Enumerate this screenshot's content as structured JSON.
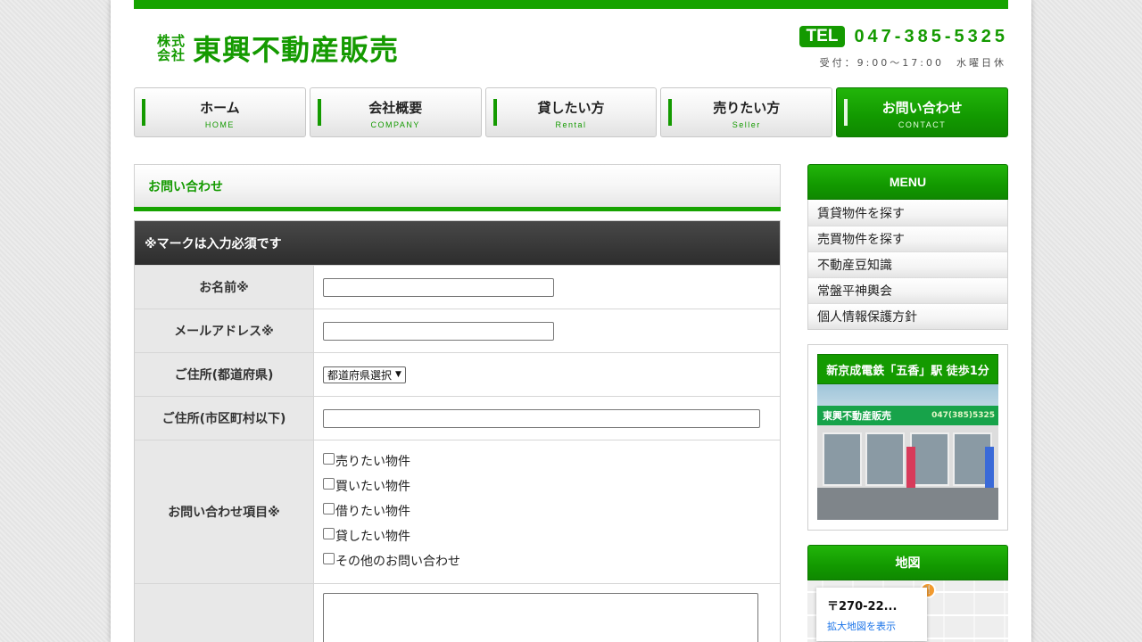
{
  "colors": {
    "brand": "#149a00",
    "header_dark": "#333333"
  },
  "logo": {
    "small_line1": "株式",
    "small_line2": "会社",
    "name": "東興不動産販売"
  },
  "contact": {
    "tel_badge": "TEL",
    "tel_number": "047-385-5325",
    "hours": "受付：9:00～17:00　水曜日休"
  },
  "nav": [
    {
      "label": "ホーム",
      "sub": "HOME"
    },
    {
      "label": "会社概要",
      "sub": "COMPANY"
    },
    {
      "label": "貸したい方",
      "sub": "Rental"
    },
    {
      "label": "売りたい方",
      "sub": "Seller"
    },
    {
      "label": "お問い合わせ",
      "sub": "CONTACT"
    }
  ],
  "main": {
    "section_title": "お問い合わせ",
    "form": {
      "note": "※マークは入力必須です",
      "name_label": "お名前※",
      "name_value": "",
      "email_label": "メールアドレス※",
      "email_value": "",
      "pref_label": "ご住所(都道府県)",
      "pref_selected": "都道府県選択",
      "city_label": "ご住所(市区町村以下)",
      "city_value": "",
      "inquiry_label": "お問い合わせ項目※",
      "inquiry_options": [
        "売りたい物件",
        "買いたい物件",
        "借りたい物件",
        "貸したい物件",
        "その他のお問い合わせ"
      ],
      "message_value": ""
    }
  },
  "sidebar": {
    "menu_title": "MENU",
    "menu_items": [
      "賃貸物件を探す",
      "売買物件を探す",
      "不動産豆知識",
      "常盤平神輿会",
      "個人情報保護方針"
    ],
    "photo_title": "新京成電鉄「五香」駅 徒歩1分",
    "photo_sign_name": "東興不動産販売",
    "photo_sign_phone": "047(385)5325",
    "map_title": "地図",
    "map_address": "〒270-22...",
    "map_link": "拡大地図を表示"
  },
  "icons": {
    "select_arrow": "chevron-down-icon",
    "map_pin": "restaurant-pin-icon"
  }
}
